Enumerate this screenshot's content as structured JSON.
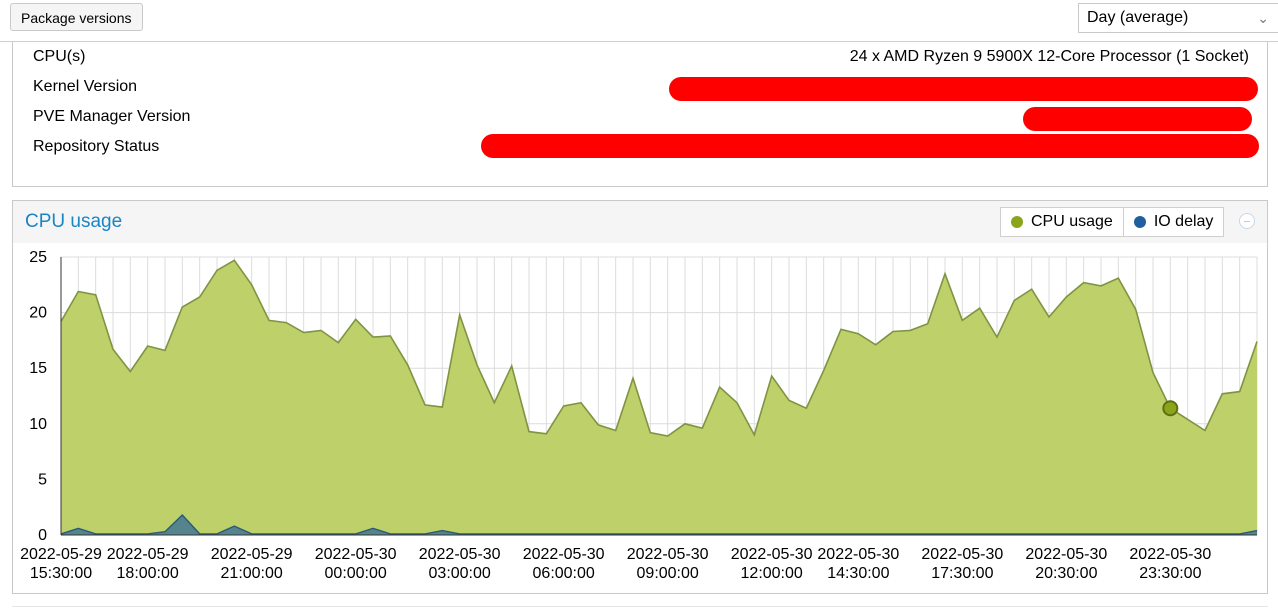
{
  "toolbar": {
    "package_versions_label": "Package versions",
    "timeframe_value": "Day (average)"
  },
  "info": {
    "rows": [
      {
        "label": "CPU(s)",
        "value": "24 x AMD Ryzen 9 5900X 12-Core Processor (1 Socket)",
        "redacted": false
      },
      {
        "label": "Kernel Version",
        "value": "",
        "redacted": true
      },
      {
        "label": "PVE Manager Version",
        "value": "",
        "redacted": true
      },
      {
        "label": "Repository Status",
        "value": "",
        "redacted": true
      }
    ],
    "redaction_color": "#ff0000"
  },
  "chart_panel": {
    "title": "CPU usage",
    "legend": [
      {
        "name": "CPU usage",
        "color": "#8aa51a"
      },
      {
        "name": "IO delay",
        "color": "#1f5f9e"
      }
    ]
  },
  "chart_data": {
    "type": "area",
    "ylim": [
      0,
      25
    ],
    "yticks": [
      0,
      5,
      10,
      15,
      20,
      25
    ],
    "grid": true,
    "legend_position": "top-right",
    "x_tick_labels": [
      {
        "date": "2022-05-29",
        "time": "15:30:00",
        "index": 0
      },
      {
        "date": "2022-05-29",
        "time": "18:00:00",
        "index": 5
      },
      {
        "date": "2022-05-29",
        "time": "21:00:00",
        "index": 11
      },
      {
        "date": "2022-05-30",
        "time": "00:00:00",
        "index": 17
      },
      {
        "date": "2022-05-30",
        "time": "03:00:00",
        "index": 23
      },
      {
        "date": "2022-05-30",
        "time": "06:00:00",
        "index": 29
      },
      {
        "date": "2022-05-30",
        "time": "09:00:00",
        "index": 35
      },
      {
        "date": "2022-05-30",
        "time": "12:00:00",
        "index": 41
      },
      {
        "date": "2022-05-30",
        "time": "14:30:00",
        "index": 46
      },
      {
        "date": "2022-05-30",
        "time": "17:30:00",
        "index": 52
      },
      {
        "date": "2022-05-30",
        "time": "20:30:00",
        "index": 58
      },
      {
        "date": "2022-05-30",
        "time": "23:30:00",
        "index": 64
      }
    ],
    "highlight_index": 64,
    "series": [
      {
        "name": "CPU usage",
        "color": "#8aa51a",
        "fill": "#bdd06a",
        "values": [
          19.2,
          21.9,
          21.6,
          16.7,
          14.7,
          17.0,
          16.6,
          20.5,
          21.4,
          23.8,
          24.7,
          22.5,
          19.3,
          19.1,
          18.2,
          18.4,
          17.3,
          19.4,
          17.8,
          17.9,
          15.3,
          11.7,
          11.5,
          19.8,
          15.3,
          11.9,
          15.2,
          9.3,
          9.1,
          11.6,
          11.9,
          9.9,
          9.4,
          14.1,
          9.2,
          8.9,
          10.0,
          9.6,
          13.3,
          11.9,
          9.0,
          14.3,
          12.1,
          11.4,
          14.8,
          18.5,
          18.1,
          17.1,
          18.3,
          18.4,
          19.0,
          23.5,
          19.3,
          20.4,
          17.8,
          21.1,
          22.1,
          19.6,
          21.4,
          22.7,
          22.4,
          23.1,
          20.3,
          14.6,
          11.4,
          10.4,
          9.4,
          12.7,
          12.9,
          17.4
        ]
      },
      {
        "name": "IO delay",
        "color": "#1f5f9e",
        "fill": "#4f7f8e",
        "values": [
          0.1,
          0.6,
          0.1,
          0.1,
          0.1,
          0.1,
          0.3,
          1.8,
          0.1,
          0.1,
          0.8,
          0.1,
          0.1,
          0.1,
          0.1,
          0.1,
          0.1,
          0.1,
          0.6,
          0.1,
          0.1,
          0.1,
          0.4,
          0.1,
          0.1,
          0.1,
          0.1,
          0.1,
          0.1,
          0.1,
          0.1,
          0.1,
          0.1,
          0.1,
          0.1,
          0.1,
          0.1,
          0.1,
          0.1,
          0.1,
          0.1,
          0.1,
          0.1,
          0.1,
          0.1,
          0.1,
          0.1,
          0.1,
          0.1,
          0.1,
          0.1,
          0.1,
          0.1,
          0.1,
          0.1,
          0.1,
          0.1,
          0.1,
          0.1,
          0.1,
          0.1,
          0.1,
          0.1,
          0.1,
          0.1,
          0.1,
          0.1,
          0.1,
          0.1,
          0.4
        ]
      }
    ]
  }
}
